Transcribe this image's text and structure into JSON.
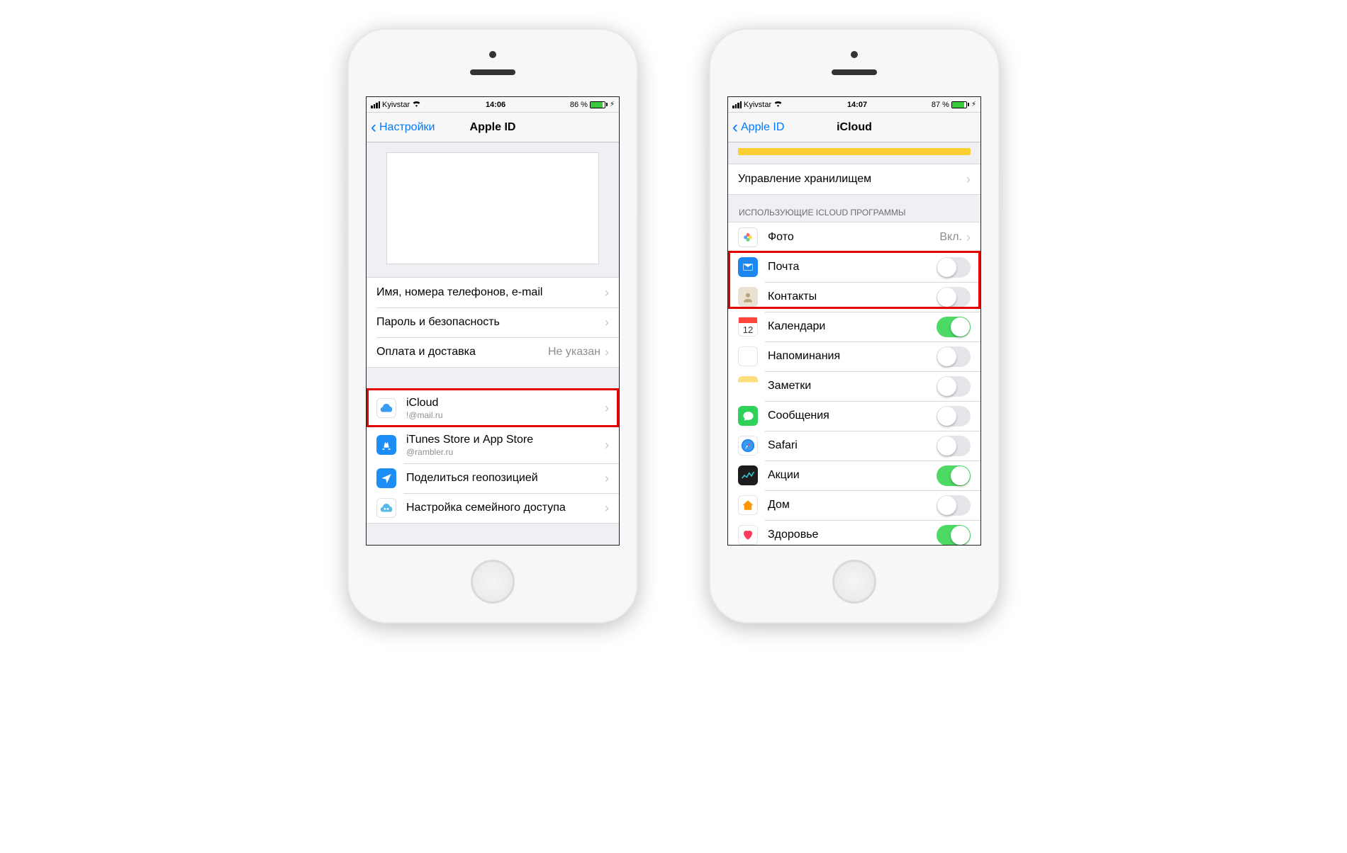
{
  "left": {
    "status": {
      "carrier": "Kyivstar",
      "time": "14:06",
      "battery": "86 %"
    },
    "nav": {
      "back": "Настройки",
      "title": "Apple ID"
    },
    "section1": [
      {
        "label": "Имя, номера телефонов, e-mail"
      },
      {
        "label": "Пароль и безопасность"
      },
      {
        "label": "Оплата и доставка",
        "value": "Не указан"
      }
    ],
    "section2": [
      {
        "label": "iCloud",
        "sub": "!@mail.ru",
        "icon": "icloud"
      },
      {
        "label": "iTunes Store и App Store",
        "sub": "@rambler.ru",
        "icon": "appstore"
      },
      {
        "label": "Поделиться геопозицией",
        "icon": "share-location"
      },
      {
        "label": "Настройка семейного доступа",
        "icon": "family"
      }
    ]
  },
  "right": {
    "status": {
      "carrier": "Kyivstar",
      "time": "14:07",
      "battery": "87 %"
    },
    "nav": {
      "back": "Apple ID",
      "title": "iCloud"
    },
    "storage_row": {
      "label": "Управление хранилищем"
    },
    "group_header": "ИСПОЛЬЗУЮЩИЕ ICLOUD ПРОГРАММЫ",
    "apps": [
      {
        "label": "Фото",
        "type": "value",
        "value": "Вкл.",
        "icon": "photos"
      },
      {
        "label": "Почта",
        "type": "toggle",
        "on": false,
        "icon": "mail"
      },
      {
        "label": "Контакты",
        "type": "toggle",
        "on": false,
        "icon": "contacts"
      },
      {
        "label": "Календари",
        "type": "toggle",
        "on": true,
        "icon": "calendar"
      },
      {
        "label": "Напоминания",
        "type": "toggle",
        "on": false,
        "icon": "reminders"
      },
      {
        "label": "Заметки",
        "type": "toggle",
        "on": false,
        "icon": "notes"
      },
      {
        "label": "Сообщения",
        "type": "toggle",
        "on": false,
        "icon": "messages"
      },
      {
        "label": "Safari",
        "type": "toggle",
        "on": false,
        "icon": "safari"
      },
      {
        "label": "Акции",
        "type": "toggle",
        "on": true,
        "icon": "stocks"
      },
      {
        "label": "Дом",
        "type": "toggle",
        "on": false,
        "icon": "home"
      },
      {
        "label": "Здоровье",
        "type": "toggle",
        "on": true,
        "icon": "health"
      }
    ]
  }
}
